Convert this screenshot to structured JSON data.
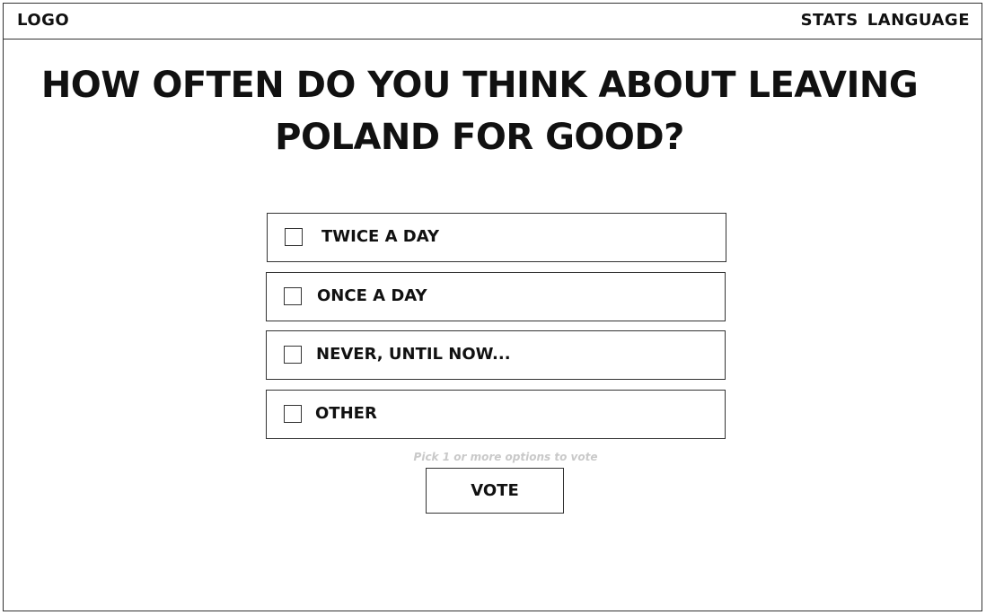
{
  "header": {
    "logo": "LOGO",
    "nav": {
      "stats": "STATS",
      "language": "LANGUAGE"
    }
  },
  "poll": {
    "question_line1": "HOW OFTEN DO YOU THINK ABOUT LEAVING",
    "question_line2": "POLAND FOR GOOD?",
    "options": [
      {
        "label": "TWICE A DAY",
        "checked": false
      },
      {
        "label": "ONCE A DAY",
        "checked": false
      },
      {
        "label": "NEVER, UNTIL NOW...",
        "checked": false
      },
      {
        "label": "OTHER",
        "checked": false
      }
    ],
    "hint": "Pick 1 or more options to vote",
    "vote_label": "VOTE"
  },
  "colors": {
    "border": "#333333",
    "text": "#111111",
    "hint": "#c9c9c9",
    "background": "#ffffff"
  }
}
